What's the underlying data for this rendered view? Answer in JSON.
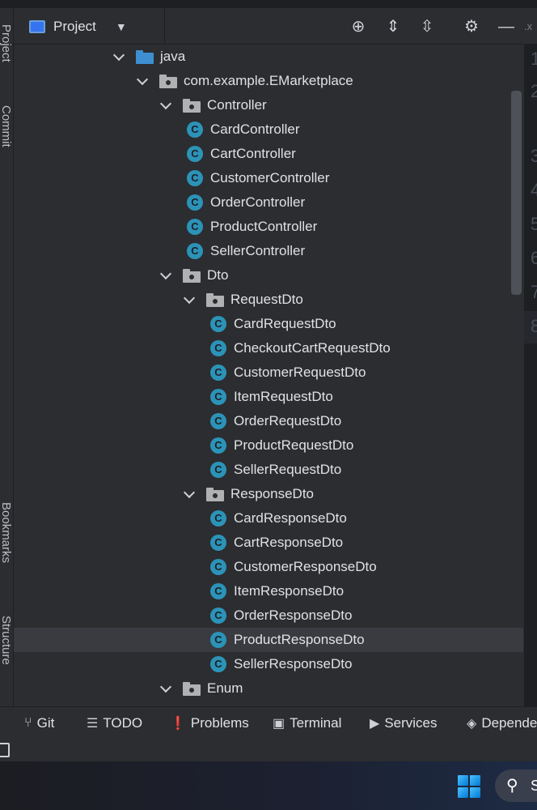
{
  "toolbar": {
    "title": "Project",
    "icons": [
      "locate-icon",
      "expand-all-icon",
      "collapse-all-icon",
      "settings-icon",
      "minimize-icon"
    ]
  },
  "left_rail": {
    "tabs": [
      "Project",
      "Commit",
      "Bookmarks",
      "Structure"
    ]
  },
  "tree": {
    "rows": [
      {
        "label": "java",
        "kind": "folder-source",
        "depth": 0
      },
      {
        "label": "com.example.EMarketplace",
        "kind": "package",
        "depth": 1
      },
      {
        "label": "Controller",
        "kind": "package",
        "depth": 2
      },
      {
        "label": "CardController",
        "kind": "class",
        "depth": 3
      },
      {
        "label": "CartController",
        "kind": "class",
        "depth": 3
      },
      {
        "label": "CustomerController",
        "kind": "class",
        "depth": 3
      },
      {
        "label": "OrderController",
        "kind": "class",
        "depth": 3
      },
      {
        "label": "ProductController",
        "kind": "class",
        "depth": 3
      },
      {
        "label": "SellerController",
        "kind": "class",
        "depth": 3
      },
      {
        "label": "Dto",
        "kind": "package",
        "depth": 2
      },
      {
        "label": "RequestDto",
        "kind": "package",
        "depth": 3
      },
      {
        "label": "CardRequestDto",
        "kind": "class",
        "depth": 4
      },
      {
        "label": "CheckoutCartRequestDto",
        "kind": "class",
        "depth": 4
      },
      {
        "label": "CustomerRequestDto",
        "kind": "class",
        "depth": 4
      },
      {
        "label": "ItemRequestDto",
        "kind": "class",
        "depth": 4
      },
      {
        "label": "OrderRequestDto",
        "kind": "class",
        "depth": 4
      },
      {
        "label": "ProductRequestDto",
        "kind": "class",
        "depth": 4
      },
      {
        "label": "SellerRequestDto",
        "kind": "class",
        "depth": 4
      },
      {
        "label": "ResponseDto",
        "kind": "package",
        "depth": 3
      },
      {
        "label": "CardResponseDto",
        "kind": "class",
        "depth": 4
      },
      {
        "label": "CartResponseDto",
        "kind": "class",
        "depth": 4
      },
      {
        "label": "CustomerResponseDto",
        "kind": "class",
        "depth": 4
      },
      {
        "label": "ItemResponseDto",
        "kind": "class",
        "depth": 4
      },
      {
        "label": "OrderResponseDto",
        "kind": "class",
        "depth": 4
      },
      {
        "label": "ProductResponseDto",
        "kind": "class",
        "depth": 4,
        "selected": true
      },
      {
        "label": "SellerResponseDto",
        "kind": "class",
        "depth": 4
      },
      {
        "label": "Enum",
        "kind": "package",
        "depth": 2
      }
    ],
    "class_glyph": "C"
  },
  "editor": {
    "tab_fragment": ".x",
    "line_numbers": [
      "1",
      "2",
      "3",
      "4",
      "5",
      "6",
      "7",
      "8"
    ]
  },
  "bottom_tools": [
    {
      "label": "Git",
      "icon": "git-branch-icon",
      "glyph": "⑂"
    },
    {
      "label": "TODO",
      "icon": "todo-list-icon",
      "glyph": "☰"
    },
    {
      "label": "Problems",
      "icon": "problems-icon",
      "glyph": "❗"
    },
    {
      "label": "Terminal",
      "icon": "terminal-icon",
      "glyph": "▣"
    },
    {
      "label": "Services",
      "icon": "services-icon",
      "glyph": "▶"
    },
    {
      "label": "Depende",
      "icon": "dependencies-icon",
      "glyph": "◈"
    }
  ],
  "taskbar": {
    "search_label": "S"
  }
}
